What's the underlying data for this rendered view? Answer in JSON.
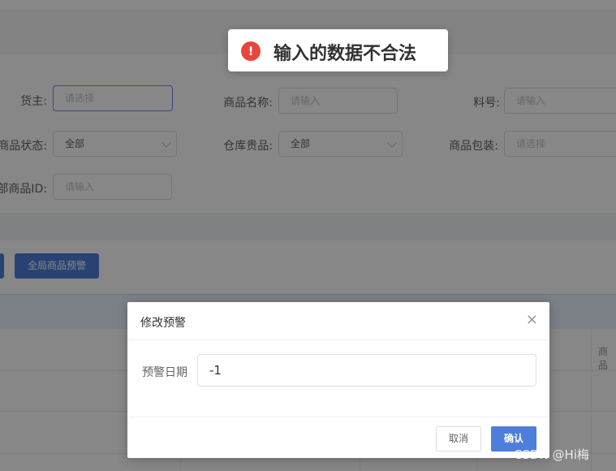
{
  "toast": {
    "icon": "!",
    "message": "输入的数据不合法"
  },
  "form": {
    "owner": {
      "label": "货主:",
      "placeholder": "请选择"
    },
    "product_name": {
      "label": "商品名称:",
      "placeholder": "请输入"
    },
    "sku": {
      "label": "料号:",
      "placeholder": "请输入"
    },
    "product_status": {
      "label": "商品状态:",
      "value": "全部"
    },
    "warehouse_valuable": {
      "label": "仓库贵品:",
      "value": "全部"
    },
    "packaging": {
      "label": "商品包装:",
      "placeholder": "请选择"
    },
    "external_id": {
      "label": "部商品ID:",
      "placeholder": "请输入"
    }
  },
  "toolbar": {
    "global_alert_label": "全局商品预警"
  },
  "table": {
    "partial_header": "商品"
  },
  "dialog": {
    "title": "修改预警",
    "close_icon": "×",
    "field_label": "预警日期",
    "field_value": "-1",
    "cancel_label": "取消",
    "confirm_label": "确认"
  },
  "watermark": "CSDN @Hi梅"
}
